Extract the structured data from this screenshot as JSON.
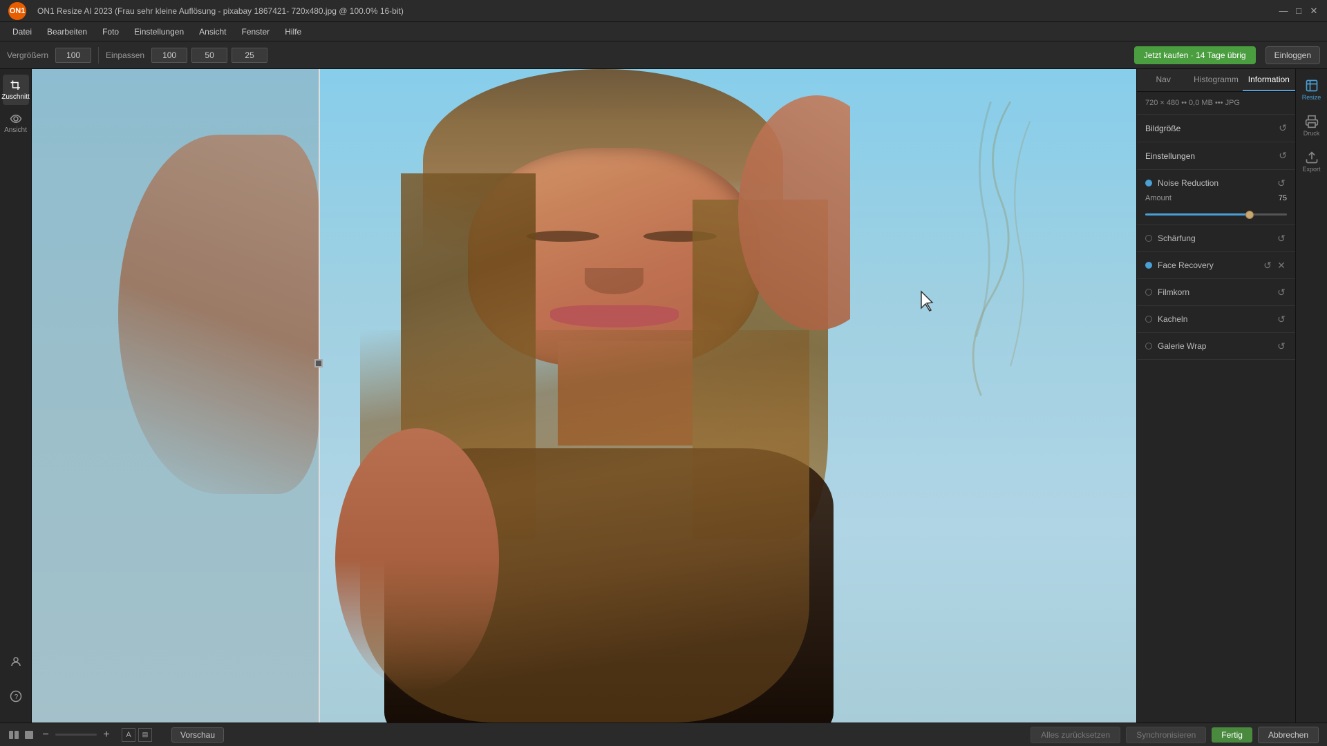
{
  "titlebar": {
    "title": "ON1 Resize AI 2023 (Frau sehr kleine Auflösung - pixabay 1867421- 720x480.jpg @ 100.0% 16-bit)",
    "minimize": "—",
    "maximize": "□",
    "close": "✕"
  },
  "menubar": {
    "items": [
      "Datei",
      "Bearbeiten",
      "Foto",
      "Einstellungen",
      "Ansicht",
      "Fenster",
      "Hilfe"
    ]
  },
  "toolbar": {
    "vergrossern_label": "Vergrößern",
    "vergrossern_value": "100",
    "einpassen_label": "Einpassen",
    "einpassen_value": "100",
    "value2": "50",
    "value3": "25",
    "buy_button": "Jetzt kaufen · 14 Tage übrig",
    "login_button": "Einloggen"
  },
  "left_sidebar": {
    "tools": [
      {
        "name": "Zuschnitt",
        "label": "Zuschnitt"
      },
      {
        "name": "Ansicht",
        "label": "Ansicht"
      }
    ]
  },
  "panel": {
    "tabs": [
      "Nav",
      "Histogramm",
      "Information"
    ],
    "active_tab": "Information",
    "image_info": "720 × 480 •• 0,0 MB ••• JPG",
    "bildgrosse_label": "Bildgröße",
    "einstellungen_label": "Einstellungen",
    "filters": [
      {
        "name": "Noise Reduction",
        "active": true,
        "has_amount": true,
        "amount_label": "Amount",
        "amount_value": "75",
        "slider_percent": 75
      },
      {
        "name": "Schärfung",
        "active": false,
        "has_amount": false
      },
      {
        "name": "Face Recovery",
        "active": true,
        "has_amount": false,
        "has_close": true
      },
      {
        "name": "Filmkorn",
        "active": false,
        "has_amount": false
      },
      {
        "name": "Kacheln",
        "active": false,
        "has_amount": false
      },
      {
        "name": "Galerie Wrap",
        "active": false,
        "has_amount": false
      }
    ]
  },
  "right_tools": [
    {
      "name": "Resize",
      "label": "Resize"
    },
    {
      "name": "Druck",
      "label": "Druck"
    },
    {
      "name": "Export",
      "label": "Export"
    }
  ],
  "bottom_bar": {
    "preview_label": "Vorschau",
    "alles_zurucksetzen": "Alles zurücksetzen",
    "synchronisieren": "Synchronisieren",
    "fertig": "Fertig",
    "abbrechen": "Abbrechen"
  },
  "bottom_icons": {
    "user_icon": "👤",
    "help_icon": "?"
  }
}
